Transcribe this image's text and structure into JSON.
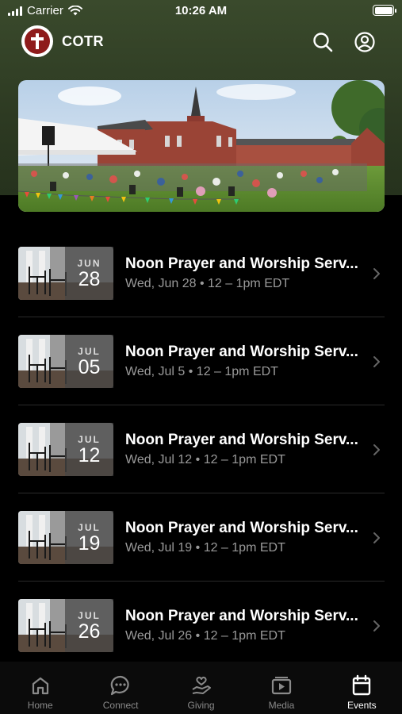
{
  "status_bar": {
    "carrier": "Carrier",
    "time": "10:26 AM"
  },
  "header": {
    "title": "COTR",
    "search_icon": "search-icon",
    "account_icon": "account-icon"
  },
  "hero": {
    "image": "outdoor-worship-gathering-church-lawn"
  },
  "events": [
    {
      "month": "JUN",
      "day": "28",
      "title": "Noon Prayer and Worship Serv...",
      "subtitle": "Wed, Jun 28 • 12 – 1pm EDT"
    },
    {
      "month": "JUL",
      "day": "05",
      "title": "Noon Prayer and Worship Serv...",
      "subtitle": "Wed, Jul 5 • 12 – 1pm EDT"
    },
    {
      "month": "JUL",
      "day": "12",
      "title": "Noon Prayer and Worship Serv...",
      "subtitle": "Wed, Jul 12 • 12 – 1pm EDT"
    },
    {
      "month": "JUL",
      "day": "19",
      "title": "Noon Prayer and Worship Serv...",
      "subtitle": "Wed, Jul 19 • 12 – 1pm EDT"
    },
    {
      "month": "JUL",
      "day": "26",
      "title": "Noon Prayer and Worship Serv...",
      "subtitle": "Wed, Jul 26 • 12 – 1pm EDT"
    }
  ],
  "tabs": [
    {
      "label": "Home",
      "icon": "home-icon",
      "active": false
    },
    {
      "label": "Connect",
      "icon": "chat-icon",
      "active": false
    },
    {
      "label": "Giving",
      "icon": "giving-icon",
      "active": false
    },
    {
      "label": "Media",
      "icon": "media-icon",
      "active": false
    },
    {
      "label": "Events",
      "icon": "calendar-icon",
      "active": true
    }
  ],
  "colors": {
    "header_bg": "#2d3a22",
    "background": "#000000",
    "logo_red": "#8e1b1b",
    "subtext": "#9a9a9a",
    "tab_inactive": "#8a8a8a",
    "tab_active": "#ffffff"
  }
}
